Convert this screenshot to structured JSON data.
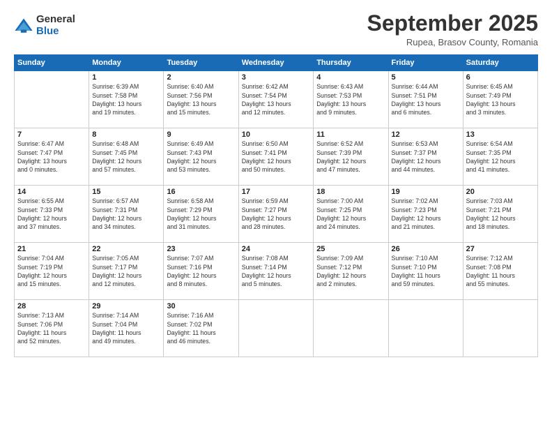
{
  "logo": {
    "general": "General",
    "blue": "Blue"
  },
  "title": "September 2025",
  "subtitle": "Rupea, Brasov County, Romania",
  "days_of_week": [
    "Sunday",
    "Monday",
    "Tuesday",
    "Wednesday",
    "Thursday",
    "Friday",
    "Saturday"
  ],
  "weeks": [
    [
      {
        "day": "",
        "detail": ""
      },
      {
        "day": "1",
        "detail": "Sunrise: 6:39 AM\nSunset: 7:58 PM\nDaylight: 13 hours\nand 19 minutes."
      },
      {
        "day": "2",
        "detail": "Sunrise: 6:40 AM\nSunset: 7:56 PM\nDaylight: 13 hours\nand 15 minutes."
      },
      {
        "day": "3",
        "detail": "Sunrise: 6:42 AM\nSunset: 7:54 PM\nDaylight: 13 hours\nand 12 minutes."
      },
      {
        "day": "4",
        "detail": "Sunrise: 6:43 AM\nSunset: 7:53 PM\nDaylight: 13 hours\nand 9 minutes."
      },
      {
        "day": "5",
        "detail": "Sunrise: 6:44 AM\nSunset: 7:51 PM\nDaylight: 13 hours\nand 6 minutes."
      },
      {
        "day": "6",
        "detail": "Sunrise: 6:45 AM\nSunset: 7:49 PM\nDaylight: 13 hours\nand 3 minutes."
      }
    ],
    [
      {
        "day": "7",
        "detail": "Sunrise: 6:47 AM\nSunset: 7:47 PM\nDaylight: 13 hours\nand 0 minutes."
      },
      {
        "day": "8",
        "detail": "Sunrise: 6:48 AM\nSunset: 7:45 PM\nDaylight: 12 hours\nand 57 minutes."
      },
      {
        "day": "9",
        "detail": "Sunrise: 6:49 AM\nSunset: 7:43 PM\nDaylight: 12 hours\nand 53 minutes."
      },
      {
        "day": "10",
        "detail": "Sunrise: 6:50 AM\nSunset: 7:41 PM\nDaylight: 12 hours\nand 50 minutes."
      },
      {
        "day": "11",
        "detail": "Sunrise: 6:52 AM\nSunset: 7:39 PM\nDaylight: 12 hours\nand 47 minutes."
      },
      {
        "day": "12",
        "detail": "Sunrise: 6:53 AM\nSunset: 7:37 PM\nDaylight: 12 hours\nand 44 minutes."
      },
      {
        "day": "13",
        "detail": "Sunrise: 6:54 AM\nSunset: 7:35 PM\nDaylight: 12 hours\nand 41 minutes."
      }
    ],
    [
      {
        "day": "14",
        "detail": "Sunrise: 6:55 AM\nSunset: 7:33 PM\nDaylight: 12 hours\nand 37 minutes."
      },
      {
        "day": "15",
        "detail": "Sunrise: 6:57 AM\nSunset: 7:31 PM\nDaylight: 12 hours\nand 34 minutes."
      },
      {
        "day": "16",
        "detail": "Sunrise: 6:58 AM\nSunset: 7:29 PM\nDaylight: 12 hours\nand 31 minutes."
      },
      {
        "day": "17",
        "detail": "Sunrise: 6:59 AM\nSunset: 7:27 PM\nDaylight: 12 hours\nand 28 minutes."
      },
      {
        "day": "18",
        "detail": "Sunrise: 7:00 AM\nSunset: 7:25 PM\nDaylight: 12 hours\nand 24 minutes."
      },
      {
        "day": "19",
        "detail": "Sunrise: 7:02 AM\nSunset: 7:23 PM\nDaylight: 12 hours\nand 21 minutes."
      },
      {
        "day": "20",
        "detail": "Sunrise: 7:03 AM\nSunset: 7:21 PM\nDaylight: 12 hours\nand 18 minutes."
      }
    ],
    [
      {
        "day": "21",
        "detail": "Sunrise: 7:04 AM\nSunset: 7:19 PM\nDaylight: 12 hours\nand 15 minutes."
      },
      {
        "day": "22",
        "detail": "Sunrise: 7:05 AM\nSunset: 7:17 PM\nDaylight: 12 hours\nand 12 minutes."
      },
      {
        "day": "23",
        "detail": "Sunrise: 7:07 AM\nSunset: 7:16 PM\nDaylight: 12 hours\nand 8 minutes."
      },
      {
        "day": "24",
        "detail": "Sunrise: 7:08 AM\nSunset: 7:14 PM\nDaylight: 12 hours\nand 5 minutes."
      },
      {
        "day": "25",
        "detail": "Sunrise: 7:09 AM\nSunset: 7:12 PM\nDaylight: 12 hours\nand 2 minutes."
      },
      {
        "day": "26",
        "detail": "Sunrise: 7:10 AM\nSunset: 7:10 PM\nDaylight: 11 hours\nand 59 minutes."
      },
      {
        "day": "27",
        "detail": "Sunrise: 7:12 AM\nSunset: 7:08 PM\nDaylight: 11 hours\nand 55 minutes."
      }
    ],
    [
      {
        "day": "28",
        "detail": "Sunrise: 7:13 AM\nSunset: 7:06 PM\nDaylight: 11 hours\nand 52 minutes."
      },
      {
        "day": "29",
        "detail": "Sunrise: 7:14 AM\nSunset: 7:04 PM\nDaylight: 11 hours\nand 49 minutes."
      },
      {
        "day": "30",
        "detail": "Sunrise: 7:16 AM\nSunset: 7:02 PM\nDaylight: 11 hours\nand 46 minutes."
      },
      {
        "day": "",
        "detail": ""
      },
      {
        "day": "",
        "detail": ""
      },
      {
        "day": "",
        "detail": ""
      },
      {
        "day": "",
        "detail": ""
      }
    ]
  ]
}
